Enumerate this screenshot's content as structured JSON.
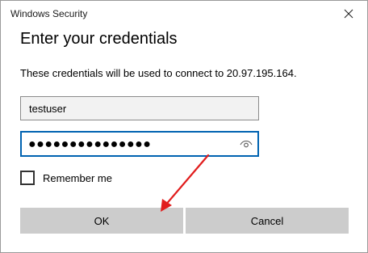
{
  "window": {
    "title": "Windows Security"
  },
  "dialog": {
    "heading": "Enter your credentials",
    "description": "These credentials will be used to connect to 20.97.195.164."
  },
  "fields": {
    "username_value": "testuser",
    "password_masked": "●●●●●●●●●●●●●●●"
  },
  "remember": {
    "label": "Remember me",
    "checked": false
  },
  "buttons": {
    "ok_label": "OK",
    "cancel_label": "Cancel"
  },
  "icons": {
    "close": "close-icon",
    "reveal_password": "eye-icon"
  },
  "colors": {
    "focus_border": "#0063b1",
    "annotation_arrow": "#e11d1d",
    "button_bg": "#cccccc"
  }
}
